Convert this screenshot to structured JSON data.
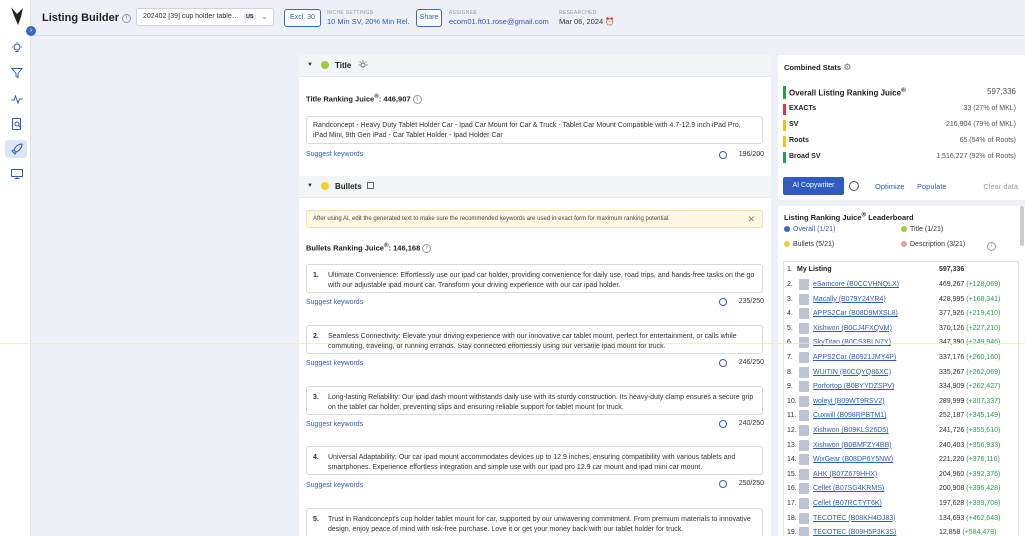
{
  "app": {
    "title": "Listing Builder"
  },
  "product": {
    "selected": "202402 [39] cup holder tablet mount",
    "marketplace": "US"
  },
  "toolbar": {
    "excl": "Excl. 30",
    "share": "Share"
  },
  "meta": {
    "niche_label": "NICHE SETTINGS",
    "niche_value": "10 Min SV, 20% Min Rel.",
    "assignee_label": "ASSIGNEE",
    "assignee_value": "ecom01.ft01.rose@gmail.com",
    "researched_label": "RESEARCHED",
    "researched_value": "Mar 06, 2024"
  },
  "colors": {
    "accent": "#2f5cbe",
    "green": "#2e9a50",
    "title_dot": "#9ccc3c",
    "bullets_dot": "#f2d22a"
  },
  "title_section": {
    "header": "Title",
    "juice_label": "Title Ranking Juice",
    "juice_value": "446,907",
    "text": "Randconcept - Heavy Duty Tablet Holder Car - Ipad Car Mount for Car & Truck - Tablet Car Mount Compatible with 4.7-12.9 inch iPad Pro, iPad Mini, 9th Gen iPad - Car Tablet Holder - Ipad Holder Car",
    "suggest": "Suggest keywords",
    "count": "196/200"
  },
  "bullets_section": {
    "header": "Bullets",
    "notice": "After using AI, edit the generated text to make sure the recommended keywords are used in exact form for maximum ranking potential.",
    "juice_label": "Bullets Ranking Juice",
    "juice_value": "146,168",
    "suggest": "Suggest keywords",
    "items": [
      {
        "num": "1.",
        "text": "Ultimate Convenience: Effortlessly use our ipad car holder, providing convenience for daily use, road trips, and hands-free tasks on the go with our adjustable ipad mount car. Transform your driving experience with our car ipad holder.",
        "count": "235/250"
      },
      {
        "num": "2.",
        "text": "Seamless Connectivity: Elevate your driving experience with our innovative car tablet mount, perfect for entertainment, or calls while commuting, traveling, or running errands. Stay connected effortlessly using our versatile ipad mount for truck.",
        "count": "246/250"
      },
      {
        "num": "3.",
        "text": "Long-lasting Reliability: Our ipad dash mount withstands daily use with its sturdy construction. Its heavy-duty clamp ensures a secure grip on the tablet car holder, preventing slips and ensuring reliable support for tablet mount for truck.",
        "count": "240/250"
      },
      {
        "num": "4.",
        "text": "Universal Adaptability: Our car ipad mount accommodates devices up to 12.9 inches, ensuring compatibility with various tablets and smartphones. Experience effortless integration and simple use with our ipad pro 12.9 car mount and ipad mini car mount.",
        "count": "250/250"
      },
      {
        "num": "5.",
        "text": "Trust in Randconcept's cup holder tablet mount for car, supported by our unwavering commitment. From premium materials to innovative design, enjoy peace of mind with risk-free purchase. Love it or get your money back with our tablet holder for truck.",
        "count": ""
      }
    ]
  },
  "stats": {
    "title": "Combined Stats",
    "rows": [
      {
        "label": "Overall Listing Ranking Juice",
        "value": "597,336",
        "color": "#2e9a50"
      },
      {
        "label": "EXACTs",
        "value": "33 (27% of MKL)",
        "color": "#d93a3a"
      },
      {
        "label": "SV",
        "value": "216,904 (79% of MKL)",
        "color": "#f2c21a"
      },
      {
        "label": "Roots",
        "value": "65 (54% of Roots)",
        "color": "#f2c21a"
      },
      {
        "label": "Broad SV",
        "value": "1,516,227 (92% of Roots)",
        "color": "#2e9a50"
      }
    ],
    "actions": {
      "ai": "AI Copywriter",
      "optimize": "Optimize",
      "populate": "Populate",
      "clear": "Clear data"
    }
  },
  "leaderboard": {
    "title": "Listing Ranking Juice",
    "legend": [
      {
        "label": "Overall (1/21)",
        "color": "#3a68c8"
      },
      {
        "label": "Title (1/21)",
        "color": "#9ccc3c"
      },
      {
        "label": "Bullets (5/21)",
        "color": "#f2d22a"
      },
      {
        "label": "Description (3/21)",
        "color": "#e8a0a0"
      }
    ],
    "my_rank": "1.",
    "my_label": "My Listing",
    "my_score": "597,336",
    "rows": [
      {
        "rank": "2.",
        "name": "eSamcore (B0CCVHNQLX)",
        "score": "469,267",
        "diff": "(+128,069)"
      },
      {
        "rank": "3.",
        "name": "Macally (B079Y24YR4)",
        "score": "428,995",
        "diff": "(+168,341)"
      },
      {
        "rank": "4.",
        "name": "APPS2Car (B08D9MXSL8)",
        "score": "377,926",
        "diff": "(+219,410)"
      },
      {
        "rank": "5.",
        "name": "Xishwon (B0CJ4FXQVM)",
        "score": "370,126",
        "diff": "(+227,210)"
      },
      {
        "rank": "6.",
        "name": "SkyTitan (B0CS3BLN7Y)",
        "score": "347,390",
        "diff": "(+249,946)"
      },
      {
        "rank": "7.",
        "name": "APPS2Car (B0921JMY4P)",
        "score": "337,176",
        "diff": "(+260,160)"
      },
      {
        "rank": "8.",
        "name": "WUITIN (B0CQYQ86XC)",
        "score": "335,267",
        "diff": "(+262,069)"
      },
      {
        "rank": "9.",
        "name": "Porfortop (B0BYYDZSPV)",
        "score": "334,909",
        "diff": "(+262,427)"
      },
      {
        "rank": "10.",
        "name": "woleyi (B09WT9RSV2)",
        "score": "289,999",
        "diff": "(+307,337)"
      },
      {
        "rank": "11.",
        "name": "Cuxwill (B098RPBTM1)",
        "score": "252,187",
        "diff": "(+345,149)"
      },
      {
        "rank": "12.",
        "name": "Xishwon (B09KLS26D5)",
        "score": "241,726",
        "diff": "(+355,610)"
      },
      {
        "rank": "13.",
        "name": "Xishwon (B0BMFZY4BB)",
        "score": "240,403",
        "diff": "(+356,933)"
      },
      {
        "rank": "14.",
        "name": "WixGear (B08DP6Y5NW)",
        "score": "221,220",
        "diff": "(+376,116)"
      },
      {
        "rank": "15.",
        "name": "AHK (B07Z679HHX)",
        "score": "204,960",
        "diff": "(+392,376)"
      },
      {
        "rank": "16.",
        "name": "Cellet (B07SG4KRMS)",
        "score": "200,908",
        "diff": "(+396,428)"
      },
      {
        "rank": "17.",
        "name": "Cellet (B07RCTYT6K)",
        "score": "197,628",
        "diff": "(+399,708)"
      },
      {
        "rank": "18.",
        "name": "TECOTEC (B08KH4DJ83)",
        "score": "134,693",
        "diff": "(+462,643)"
      },
      {
        "rank": "19.",
        "name": "TECOTEC (B09H5P3K3S)",
        "score": "12,858",
        "diff": "(+584,478)"
      }
    ]
  }
}
